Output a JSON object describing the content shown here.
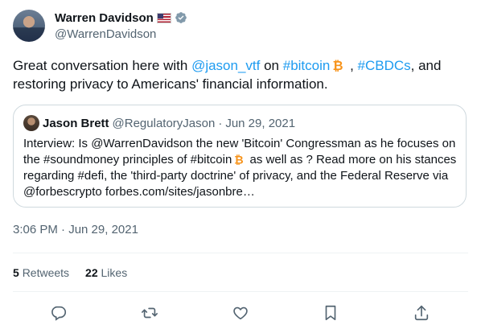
{
  "author": {
    "name": "Warren Davidson",
    "handle": "@WarrenDavidson"
  },
  "tweet": {
    "text_part1": "Great conversation here with ",
    "mention": "@jason_vtf",
    "text_part2": " on ",
    "hashtag1": "#bitcoin",
    "text_part3": " , ",
    "hashtag2": "#CBDCs",
    "text_part4": ", and restoring privacy to Americans' financial information."
  },
  "quote": {
    "name": "Jason Brett",
    "handle": "@RegulatoryJason",
    "separator": "·",
    "date": "Jun 29, 2021",
    "text_part1": "Interview: Is @WarrenDavidson the new 'Bitcoin' Congressman as he focuses on the #soundmoney principles of #bitcoin",
    "text_part2": " as well as ? Read more on his stances regarding #defi, the 'third-party doctrine' of privacy, and the Federal Reserve via @forbescrypto forbes.com/sites/jasonbre…"
  },
  "timestamp": "3:06 PM · Jun 29, 2021",
  "stats": {
    "retweets_count": "5",
    "retweets_label": "Retweets",
    "likes_count": "22",
    "likes_label": "Likes"
  },
  "colors": {
    "link": "#1d9bf0",
    "bitcoin": "#f7931a",
    "secondary_text": "#536471",
    "icon": "#536471"
  },
  "icons": [
    "reply-icon",
    "retweet-icon",
    "like-icon",
    "bookmark-icon",
    "share-icon",
    "verified-icon",
    "bitcoin-icon",
    "us-flag-icon"
  ]
}
